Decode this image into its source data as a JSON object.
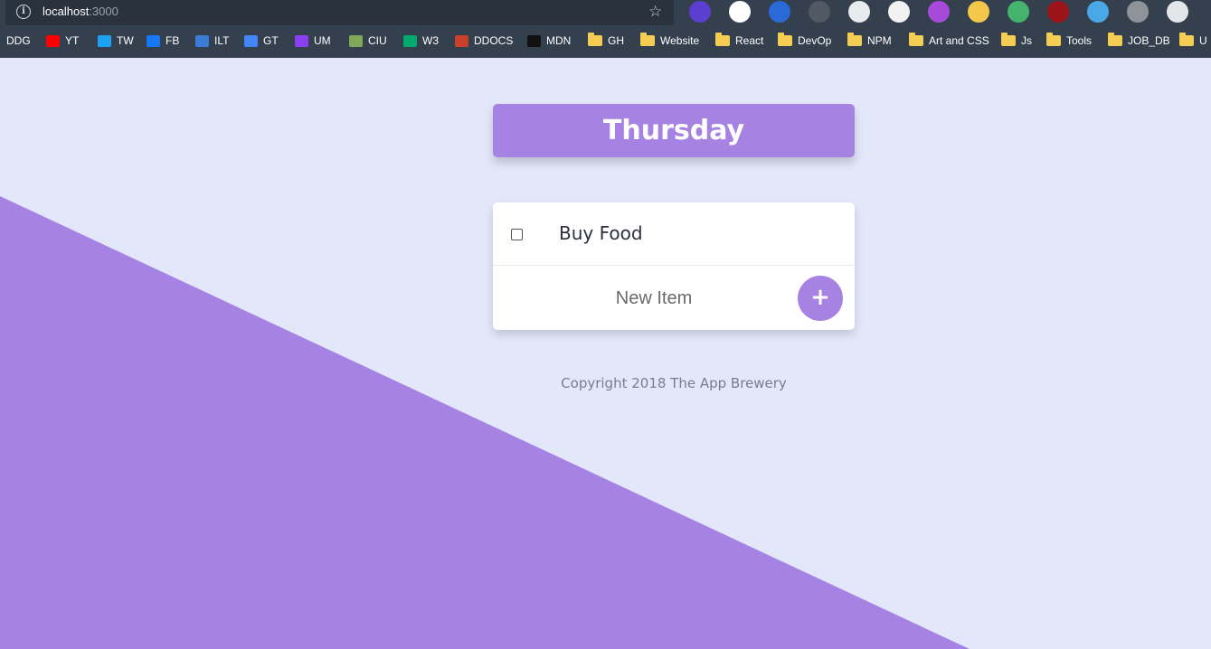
{
  "browser": {
    "url_host": "localhost",
    "url_port": ":3000",
    "extension_colors": [
      "#5b3fd0",
      "#ffffff",
      "#2a6ad8",
      "#505964",
      "#e8eaee",
      "#f2f2f2",
      "#a84ad9",
      "#f3c84a",
      "#45b36b",
      "#9b1418",
      "#4aa8e8",
      "#8f939a",
      "#e3e5e8"
    ],
    "bookmarks": [
      {
        "label": "DDG",
        "type": "site",
        "color": "#de5833"
      },
      {
        "label": "YT",
        "type": "site",
        "color": "#ff0000"
      },
      {
        "label": "TW",
        "type": "site",
        "color": "#1da1f2"
      },
      {
        "label": "FB",
        "type": "site",
        "color": "#1877f2"
      },
      {
        "label": "ILT",
        "type": "site",
        "color": "#3a7bd5"
      },
      {
        "label": "GT",
        "type": "site",
        "color": "#4285f4"
      },
      {
        "label": "UM",
        "type": "site",
        "color": "#8a3ff0"
      },
      {
        "label": "CIU",
        "type": "site",
        "color": "#7fa85a"
      },
      {
        "label": "W3",
        "type": "site",
        "color": "#04aa6d"
      },
      {
        "label": "DDOCS",
        "type": "site",
        "color": "#c9412a"
      },
      {
        "label": "MDN",
        "type": "site",
        "color": "#111111"
      },
      {
        "label": "GH",
        "type": "folder"
      },
      {
        "label": "Website",
        "type": "folder"
      },
      {
        "label": "React",
        "type": "folder"
      },
      {
        "label": "DevOp",
        "type": "folder"
      },
      {
        "label": "NPM",
        "type": "folder"
      },
      {
        "label": "Art and CSS",
        "type": "folder"
      },
      {
        "label": "Js",
        "type": "folder"
      },
      {
        "label": "Tools",
        "type": "folder"
      },
      {
        "label": "JOB_DB",
        "type": "folder"
      },
      {
        "label": "U",
        "type": "folder"
      }
    ]
  },
  "app": {
    "accent_color": "#a683e3",
    "background_color": "#e3e7fa",
    "heading": "Thursday",
    "items": [
      {
        "text": "Buy Food",
        "checked": false
      }
    ],
    "new_item_placeholder": "New Item",
    "add_button_label": "+",
    "footer": "Copyright 2018 The App Brewery"
  }
}
